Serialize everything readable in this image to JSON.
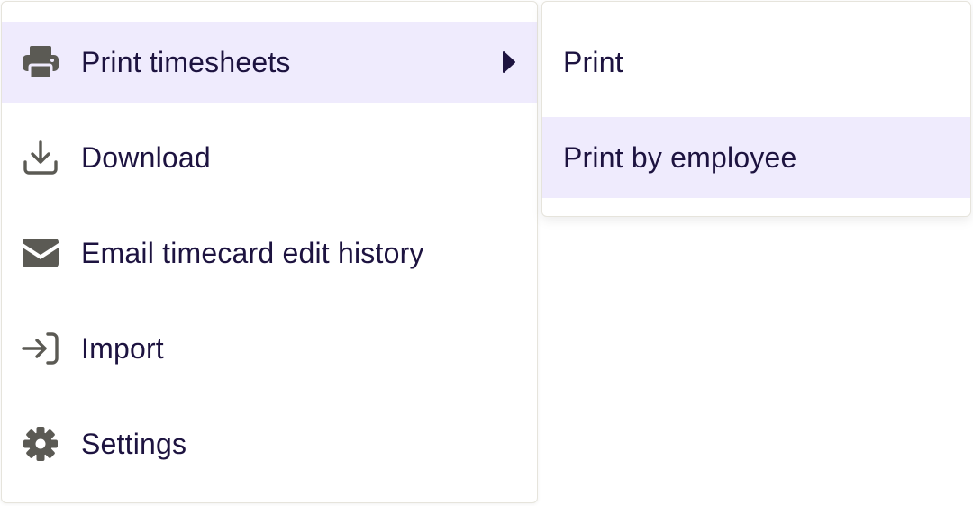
{
  "menu": {
    "items": [
      {
        "label": "Print timesheets",
        "icon": "printer-icon",
        "active": true,
        "has_submenu": true
      },
      {
        "label": "Download",
        "icon": "download-icon",
        "active": false
      },
      {
        "label": "Email timecard edit history",
        "icon": "envelope-icon",
        "active": false
      },
      {
        "label": "Import",
        "icon": "import-icon",
        "active": false
      },
      {
        "label": "Settings",
        "icon": "gear-icon",
        "active": false
      }
    ]
  },
  "submenu": {
    "items": [
      {
        "label": "Print",
        "active": false
      },
      {
        "label": "Print by employee",
        "active": true
      }
    ]
  },
  "colors": {
    "text": "#1d1340",
    "icon": "#5b5a54",
    "active_bg": "#efebfd",
    "border": "#e6e4dc"
  }
}
